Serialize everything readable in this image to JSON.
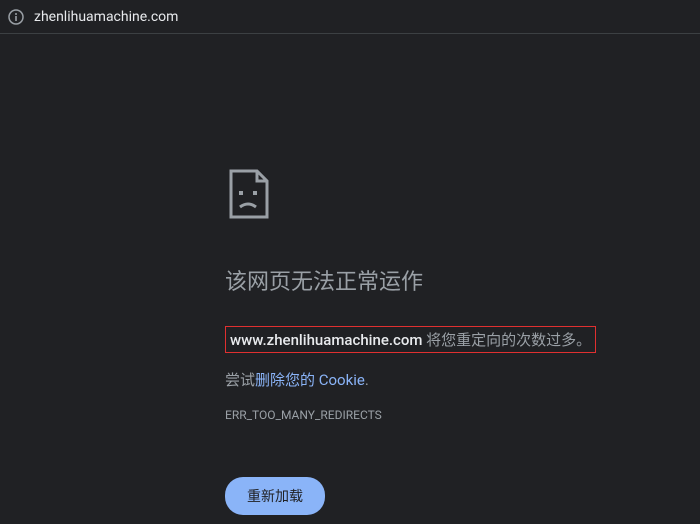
{
  "address_bar": {
    "url": "zhenlihuamachine.com"
  },
  "error": {
    "title": "该网页无法正常运作",
    "domain": "www.zhenlihuamachine.com",
    "message_suffix": " 将您重定向的次数过多。",
    "suggestion_prefix": "尝试",
    "suggestion_link": "删除您的 Cookie",
    "suggestion_suffix": ".",
    "code": "ERR_TOO_MANY_REDIRECTS",
    "reload_label": "重新加载"
  }
}
